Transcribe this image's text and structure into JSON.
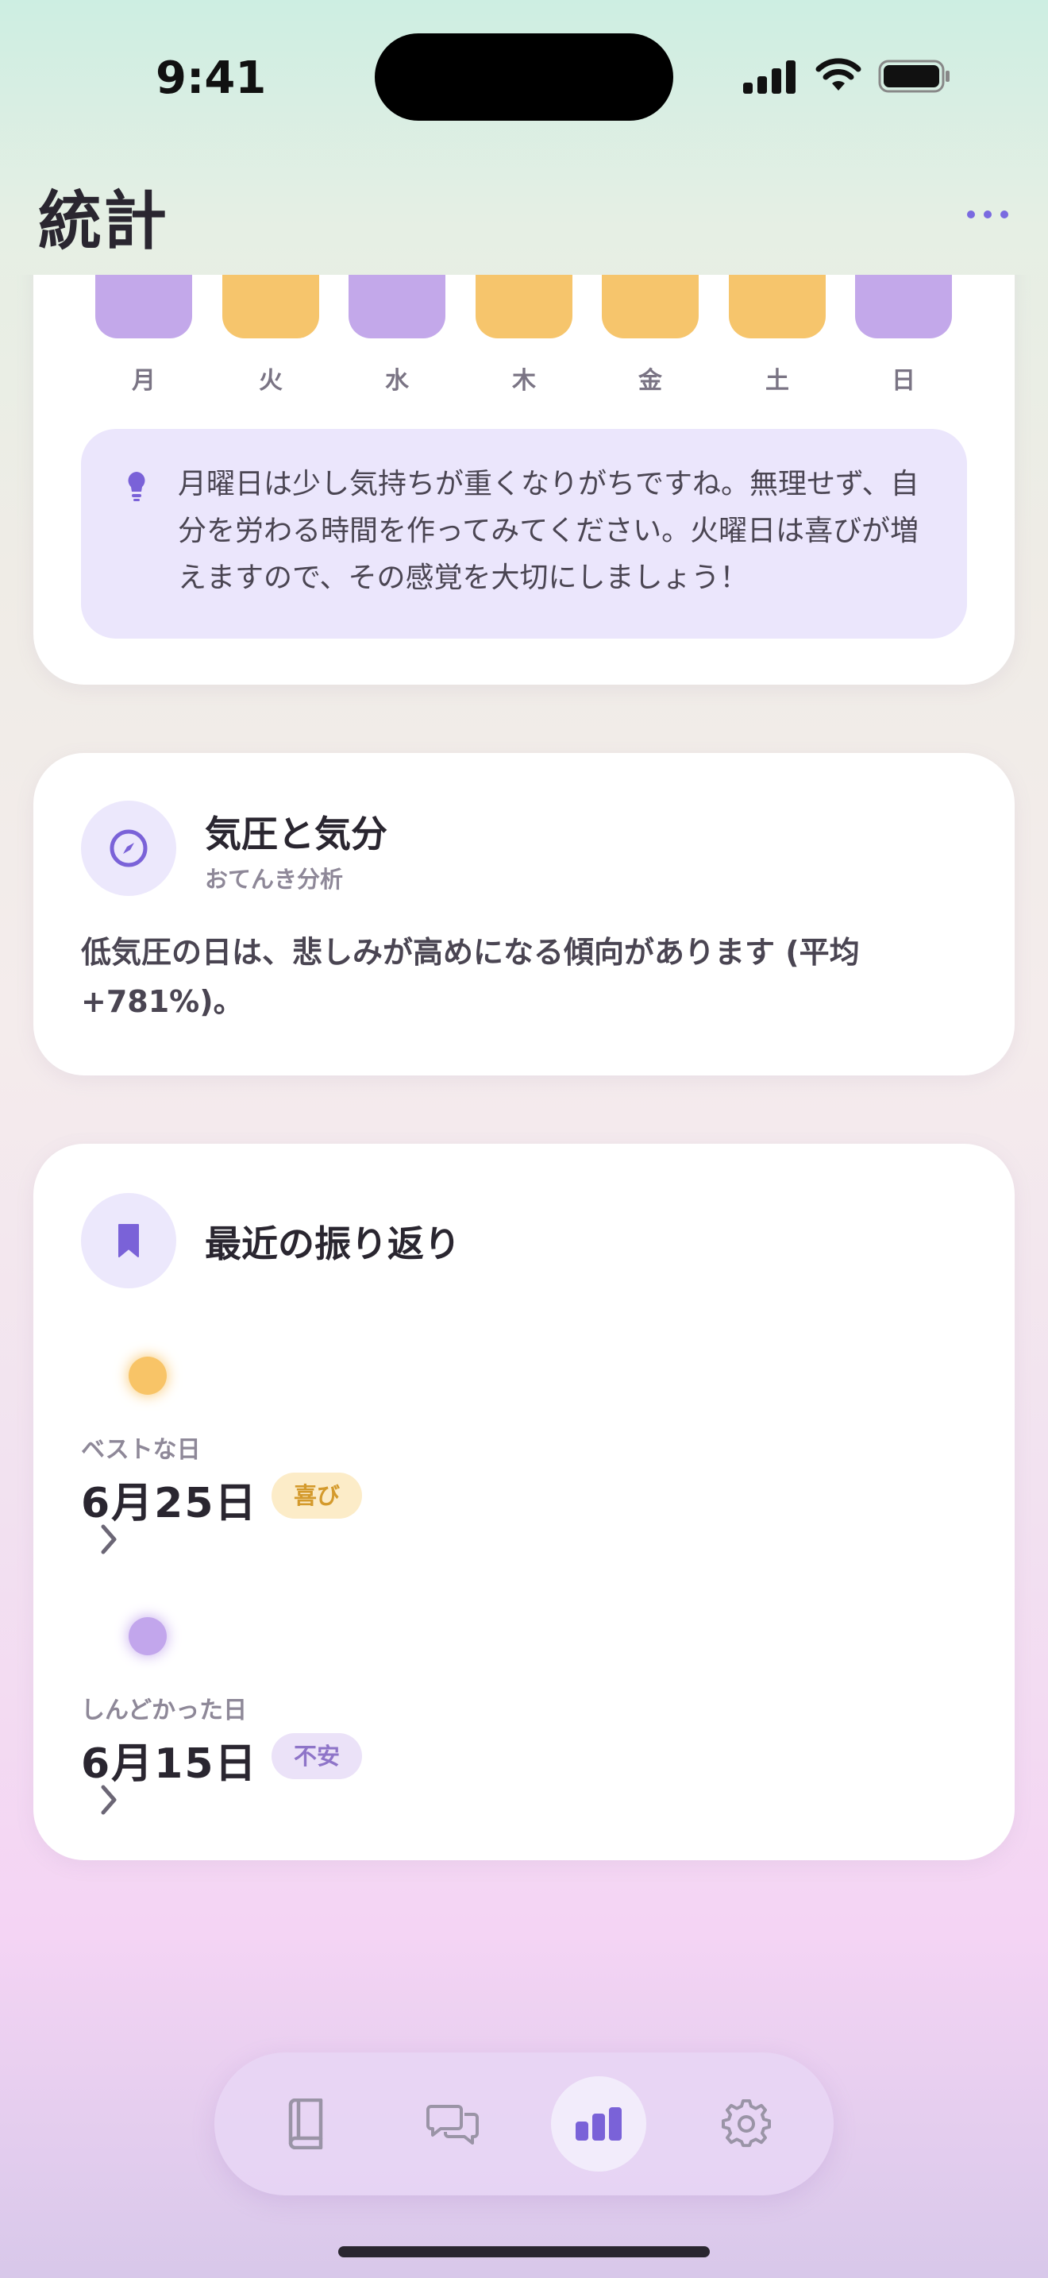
{
  "status_bar": {
    "time": "9:41"
  },
  "header": {
    "title": "統計"
  },
  "weekday_chart": {
    "days": [
      {
        "label": "月",
        "color": "#c3a8ea"
      },
      {
        "label": "火",
        "color": "#f6c56c"
      },
      {
        "label": "水",
        "color": "#c3a8ea"
      },
      {
        "label": "木",
        "color": "#f6c56c"
      },
      {
        "label": "金",
        "color": "#f6c56c"
      },
      {
        "label": "土",
        "color": "#f6c56c"
      },
      {
        "label": "日",
        "color": "#c3a8ea"
      }
    ],
    "insight": "月曜日は少し気持ちが重くなりがちですね。無理せず、自分を労わる時間を作ってみてください。火曜日は喜びが増えますので、その感覚を大切にしましょう！"
  },
  "pressure": {
    "title": "気圧と気分",
    "subtitle": "おてんき分析",
    "body": "低気圧の日は、悲しみが高めになる傾向があります (平均 +781%)。"
  },
  "recent": {
    "title": "最近の振り返り",
    "items": [
      {
        "label": "ベストな日",
        "date": "6月25日",
        "badge": "喜び",
        "dot_color": "#f8c467",
        "badge_bg": "#fcecc8",
        "badge_fg": "#d49a2c"
      },
      {
        "label": "しんどかった日",
        "date": "6月15日",
        "badge": "不安",
        "dot_color": "#c2a6ec",
        "badge_bg": "#ebe2f8",
        "badge_fg": "#8e74c8"
      }
    ]
  },
  "tab_bar": {
    "tabs": [
      {
        "name": "journal",
        "icon": "book-icon",
        "active": false
      },
      {
        "name": "chat",
        "icon": "chat-bubbles-icon",
        "active": false
      },
      {
        "name": "stats",
        "icon": "bar-chart-icon",
        "active": true
      },
      {
        "name": "settings",
        "icon": "gear-icon",
        "active": false
      }
    ]
  },
  "colors": {
    "accent": "#7a6ae0",
    "joy": "#f6c56c",
    "sad": "#c3a8ea"
  }
}
